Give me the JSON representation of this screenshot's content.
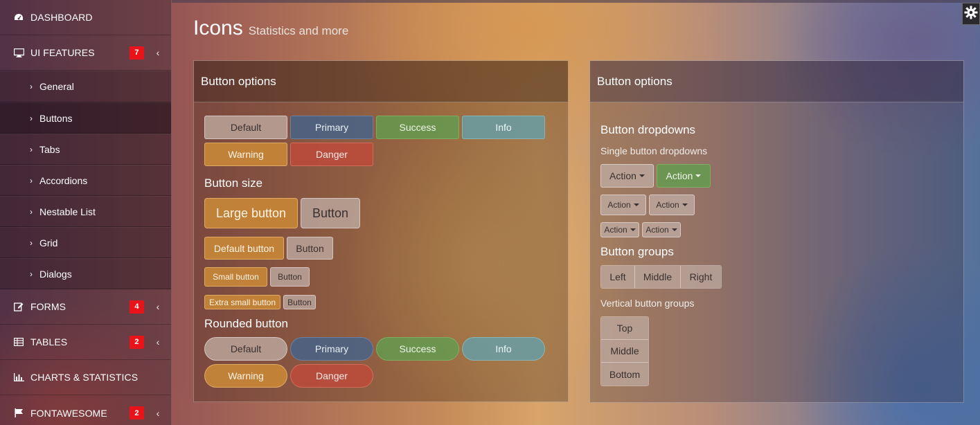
{
  "sidebar": {
    "dashboard": "DASHBOARD",
    "ui_features": {
      "label": "UI FEATURES",
      "badge": "7"
    },
    "submenu": [
      "General",
      "Buttons",
      "Tabs",
      "Accordions",
      "Nestable List",
      "Grid",
      "Dialogs"
    ],
    "active_sub": "Buttons",
    "forms": {
      "label": "FORMS",
      "badge": "4"
    },
    "tables": {
      "label": "TABLES",
      "badge": "2"
    },
    "charts": {
      "label": "CHARTS & STATISTICS"
    },
    "fontawesome": {
      "label": "FONTAWESOME",
      "badge": "2"
    }
  },
  "header": {
    "title": "Icons",
    "subtitle": "Statistics and more"
  },
  "left_panel": {
    "title": "Button options",
    "options": {
      "default": "Default",
      "primary": "Primary",
      "success": "Success",
      "info": "Info",
      "warning": "Warning",
      "danger": "Danger"
    },
    "size_title": "Button size",
    "large": "Large button",
    "large_plain": "Button",
    "default_btn": "Default button",
    "default_plain": "Button",
    "small": "Small button",
    "small_plain": "Button",
    "xsmall": "Extra small button",
    "xsmall_plain": "Button",
    "rounded_title": "Rounded button",
    "rounded": {
      "default": "Default",
      "primary": "Primary",
      "success": "Success",
      "info": "Info",
      "warning": "Warning",
      "danger": "Danger"
    }
  },
  "right_panel": {
    "title": "Button options",
    "dropdowns_title": "Button dropdowns",
    "dropdowns_sub": "Single button dropdowns",
    "action": "Action",
    "groups_title": "Button groups",
    "groups": [
      "Left",
      "Middle",
      "Right"
    ],
    "vertical_title": "Vertical button groups",
    "vertical": [
      "Top",
      "Middle",
      "Bottom"
    ]
  },
  "colors": {
    "badge": "#e8141a",
    "warning": "#c8873a",
    "danger": "#be4b3c",
    "primary": "#44648c",
    "success": "#649b50",
    "info": "#64a0aa"
  },
  "icons": [
    "dashboard-icon",
    "desktop-icon",
    "edit-icon",
    "table-icon",
    "bar-chart-icon",
    "flag-icon",
    "gear-icon",
    "chevron-left-icon",
    "chevron-right-icon",
    "caret-down-icon"
  ]
}
